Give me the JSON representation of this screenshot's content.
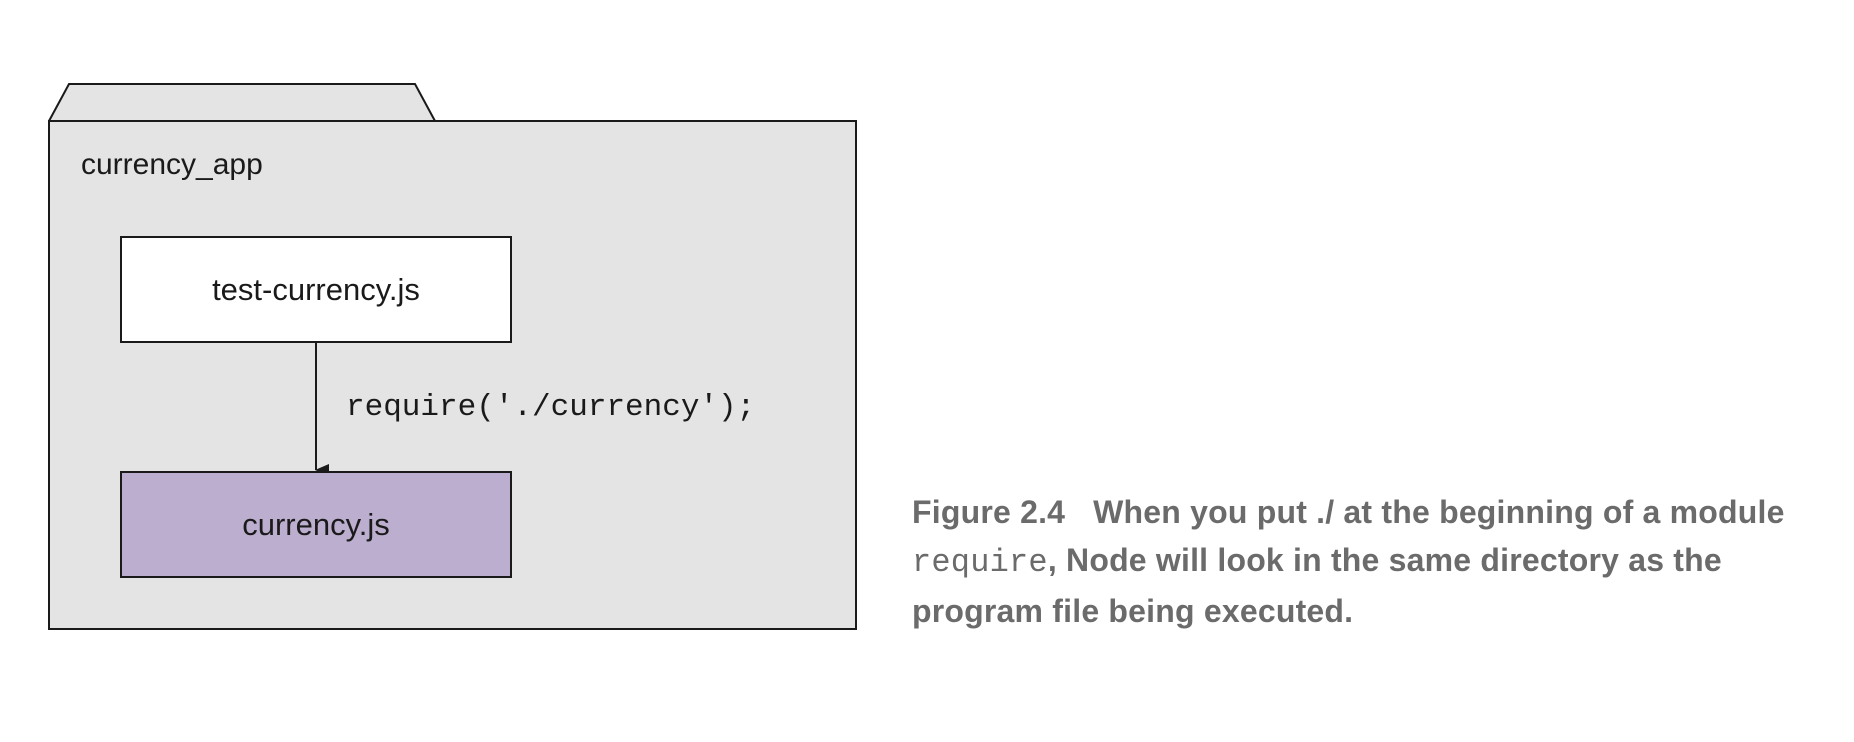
{
  "diagram": {
    "folder": {
      "name": "currency_app",
      "fill": "#e3e4e3"
    },
    "files": [
      {
        "name": "test-currency.js",
        "fill": "#ffffff"
      },
      {
        "name": "currency.js",
        "fill": "#bcaecf"
      }
    ],
    "arrow_label": "require('./currency');"
  },
  "caption": {
    "figure_number": "Figure 2.4",
    "text_before_code": "When you put ./ at the beginning of a module ",
    "code": "require",
    "text_after_code": ", Node will look in the same directory as the program file being executed.",
    "color": "#6b6b6b"
  }
}
